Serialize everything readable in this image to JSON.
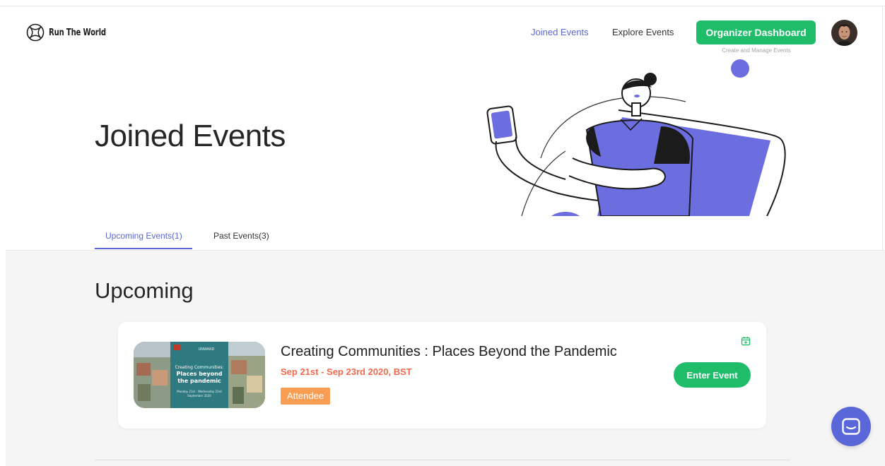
{
  "header": {
    "logo_text": "Run The World",
    "nav": {
      "joined": "Joined Events",
      "explore": "Explore Events"
    },
    "organizer_button": "Organizer Dashboard",
    "organizer_subtitle": "Create and Manage Events"
  },
  "hero": {
    "title": "Joined Events"
  },
  "tabs": [
    {
      "label": "Upcoming Events(1)",
      "active": true
    },
    {
      "label": "Past Events(3)",
      "active": false
    }
  ],
  "section": {
    "title": "Upcoming"
  },
  "event": {
    "title": "Creating Communities : Places Beyond the Pandemic",
    "date": "Sep 21st - Sep 23rd 2020, BST",
    "role": "Attendee",
    "enter_label": "Enter Event",
    "thumbnail": {
      "brand": "UNWARD",
      "headline_1": "Creating Communities:",
      "headline_2": "Places beyond",
      "headline_3": "the pandemic",
      "dates_1": "Monday 21st - Wednesday 23rd",
      "dates_2": "September 2020"
    }
  },
  "colors": {
    "accent": "#5a67d8",
    "green": "#1fbd6a",
    "orange": "#f99d52",
    "date_red": "#ee6b4d"
  },
  "icons": {
    "calendar": "calendar-icon",
    "chat": "chat-icon",
    "logo": "globe-x-icon"
  }
}
